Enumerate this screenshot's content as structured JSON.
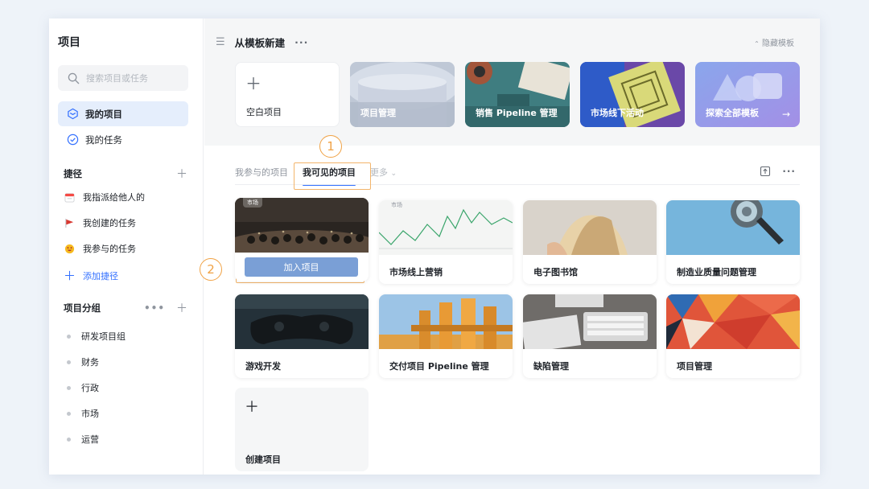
{
  "sidebar": {
    "title": "项目",
    "search_placeholder": "搜索项目或任务",
    "nav": [
      {
        "label": "我的项目",
        "icon": "project-icon",
        "active": true
      },
      {
        "label": "我的任务",
        "icon": "task-check-icon",
        "active": false
      }
    ],
    "shortcuts_title": "捷径",
    "shortcuts": [
      {
        "label": "我指派给他人的",
        "icon": "calendar-icon"
      },
      {
        "label": "我创建的任务",
        "icon": "flag-icon"
      },
      {
        "label": "我参与的任务",
        "icon": "smile-icon"
      }
    ],
    "add_shortcut": "添加捷径",
    "groups_title": "项目分组",
    "groups": [
      "研发项目组",
      "财务",
      "行政",
      "市场",
      "运营"
    ]
  },
  "templates": {
    "title": "从模板新建",
    "hide_label": "隐藏模板",
    "blank_label": "空白项目",
    "items": [
      {
        "label": "项目管理"
      },
      {
        "label": "销售 Pipeline 管理"
      },
      {
        "label": "市场线下活动"
      },
      {
        "label": "探索全部模板"
      }
    ]
  },
  "tabs": {
    "items": [
      "我参与的项目",
      "我可见的项目"
    ],
    "active_index": 1,
    "more_label": "更多"
  },
  "annotations": {
    "step1": "1",
    "step2": "2"
  },
  "projects": {
    "join_label": "加入项目",
    "first_tag": "市场",
    "second_tag": "市场",
    "items": [
      {
        "name": "市场线上营销"
      },
      {
        "name": "电子图书馆"
      },
      {
        "name": "制造业质量问题管理"
      },
      {
        "name": "游戏开发"
      },
      {
        "name": "交付项目 Pipeline 管理"
      },
      {
        "name": "缺陷管理"
      },
      {
        "name": "项目管理"
      }
    ],
    "create_label": "创建项目"
  },
  "colors": {
    "accent": "#3370ff",
    "annotation": "#f0a245",
    "join_button": "#7a9fd6"
  }
}
